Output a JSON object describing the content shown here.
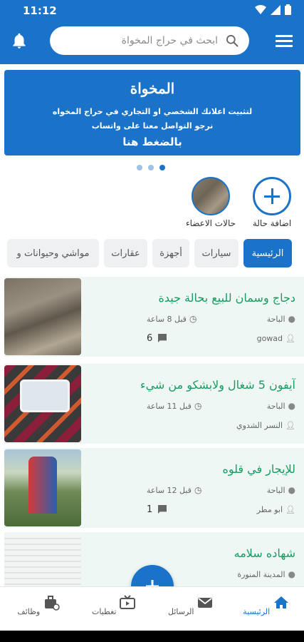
{
  "status": {
    "time": "11:12"
  },
  "search": {
    "placeholder": "ابحث في حراج المخواة"
  },
  "banner": {
    "logo": "المخواة",
    "line1": "لتثبيت اعلانك الشخصي او التجاري في حراج المخواه",
    "line2": "نرجو التواصل معنا على واتساب",
    "cta": "بالضغط هنا"
  },
  "stories": [
    {
      "label": "اضافة حالة"
    },
    {
      "label": "حالات الاعضاء"
    }
  ],
  "tabs": [
    {
      "label": "الرئيسية",
      "active": true
    },
    {
      "label": "سيارات"
    },
    {
      "label": "أجهزة"
    },
    {
      "label": "عقارات"
    },
    {
      "label": "مواشي وحيوانات و"
    }
  ],
  "listings": [
    {
      "title": "دجاج وسمان للبيع بحالة جيدة",
      "location": "الباحة",
      "time": "قبل 8 ساعة",
      "user": "gowad",
      "comments": "6"
    },
    {
      "title": "آيفون 5 شغال ولابشكو من شيء",
      "location": "الباحة",
      "time": "قبل 11 ساعة",
      "user": "النسر الشدوي",
      "comments": ""
    },
    {
      "title": "للإيجار في قلوه",
      "location": "الباحة",
      "time": "قبل 12 ساعة",
      "user": "ابو مطر",
      "comments": "1"
    },
    {
      "title": "شهاده سلامه",
      "location": "المدينة المنورة",
      "time": "",
      "user": "",
      "comments": ""
    }
  ],
  "bottom_nav": [
    {
      "label": "الرئيسية",
      "icon": "home-icon",
      "active": true
    },
    {
      "label": "الرسائل",
      "icon": "mail-icon"
    },
    {
      "label": "تغطيات",
      "icon": "tv-icon"
    },
    {
      "label": "وظائف",
      "icon": "briefcase-icon"
    }
  ],
  "colors": {
    "primary": "#1a73c8",
    "title_green": "#1a9b62",
    "card_bg": "#eef7f3"
  }
}
